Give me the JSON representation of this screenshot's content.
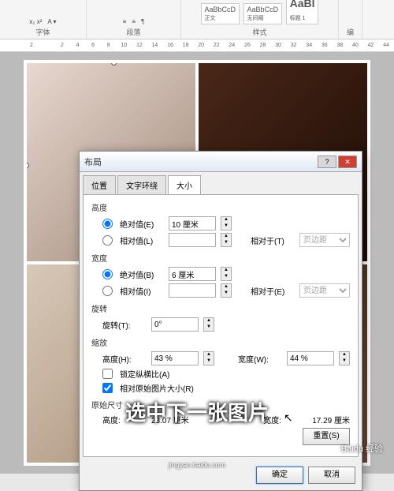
{
  "ribbon": {
    "font_label": "字体",
    "para_label": "段落",
    "style_label": "样式",
    "edit_label": "编",
    "styles": {
      "s1": "AaBbCcD",
      "s2": "AaBbCcD",
      "s3": "AaBl",
      "sub1": "正文",
      "sub2": "无间隔",
      "sub3": "标题 1"
    },
    "font_btns": "x₂ x²"
  },
  "ruler": [
    "2",
    "",
    "2",
    "4",
    "6",
    "8",
    "10",
    "12",
    "14",
    "16",
    "18",
    "20",
    "22",
    "24",
    "26",
    "28",
    "30",
    "32",
    "34",
    "36",
    "38",
    "40",
    "42",
    "44"
  ],
  "dialog": {
    "title": "布局",
    "tabs": {
      "pos": "位置",
      "wrap": "文字环绕",
      "size": "大小"
    },
    "height": {
      "label": "高度",
      "abs_label": "绝对值(E)",
      "abs_value": "10 厘米",
      "rel_label": "相对值(L)",
      "rel_to": "相对于(T)",
      "rel_to_val": "页边距"
    },
    "width": {
      "label": "宽度",
      "abs_label": "绝对值(B)",
      "abs_value": "6 厘米",
      "rel_label": "相对值(I)",
      "rel_to": "相对于(E)",
      "rel_to_val": "页边距"
    },
    "rotate": {
      "label": "旋转",
      "field": "旋转(T):",
      "value": "0°"
    },
    "scale": {
      "label": "缩放",
      "h_label": "高度(H):",
      "h_value": "43 %",
      "w_label": "宽度(W):",
      "w_value": "44 %",
      "lock": "锁定纵横比(A)",
      "relorig": "相对原始图片大小(R)"
    },
    "orig": {
      "label": "原始尺寸",
      "h_label": "高度:",
      "h_value": "23.07 厘米",
      "w_label": "宽度:",
      "w_value": "17.29 厘米"
    },
    "reset": "重置(S)",
    "ok": "确定",
    "cancel": "取消"
  },
  "caption": "选中下一张图片",
  "watermark": {
    "logo": "Baidu 经验",
    "url": "jingyan.baidu.com"
  }
}
